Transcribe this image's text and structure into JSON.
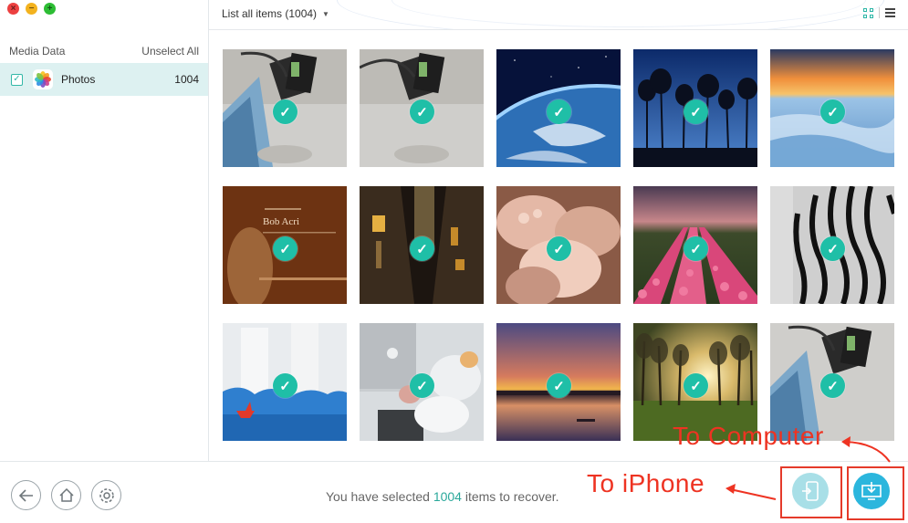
{
  "window": {
    "controls": {
      "close": "×",
      "minimize": "−",
      "zoom": "+"
    }
  },
  "sidebar": {
    "header": {
      "title": "Media Data",
      "action": "Unselect All"
    },
    "items": [
      {
        "label": "Photos",
        "count": "1004",
        "checked": true,
        "icon": "photos-app-icon"
      }
    ]
  },
  "toolbar": {
    "filter_label": "List all items (1004)",
    "view_modes": [
      "grid-view-icon",
      "list-view-icon"
    ],
    "active_view": "grid"
  },
  "photos": [
    {
      "subject": "desk-cards",
      "checked": true
    },
    {
      "subject": "desk-cards",
      "checked": true
    },
    {
      "subject": "earth-from-space",
      "checked": true
    },
    {
      "subject": "tree-silhouettes",
      "checked": true
    },
    {
      "subject": "frozen-sunset",
      "checked": true
    },
    {
      "subject": "album-cover",
      "checked": true,
      "overlay_title": "Bob Acri"
    },
    {
      "subject": "night-street",
      "checked": true
    },
    {
      "subject": "baby-feet",
      "checked": true
    },
    {
      "subject": "tulip-field",
      "checked": true
    },
    {
      "subject": "zebra",
      "checked": true
    },
    {
      "subject": "paper-boat-art",
      "checked": true
    },
    {
      "subject": "mac-desk",
      "checked": true
    },
    {
      "subject": "lake-sunset",
      "checked": true
    },
    {
      "subject": "forest-sunrise",
      "checked": true
    },
    {
      "subject": "desk-cards",
      "checked": true
    }
  ],
  "footer": {
    "nav_buttons": [
      "back-icon",
      "home-icon",
      "settings-icon"
    ],
    "status_prefix": "You have selected",
    "status_count": "1004",
    "status_suffix": "items to recover."
  },
  "actions": {
    "to_iphone": {
      "icon": "phone-transfer-icon"
    },
    "to_computer": {
      "icon": "download-to-computer-icon"
    }
  },
  "annotations": {
    "to_computer": "To Computer",
    "to_iphone": "To iPhone",
    "color": "#ee3322"
  },
  "colors": {
    "accent": "#2aa89a",
    "selection_bg": "#ddf1f1",
    "check_green": "#1fbfa7"
  }
}
